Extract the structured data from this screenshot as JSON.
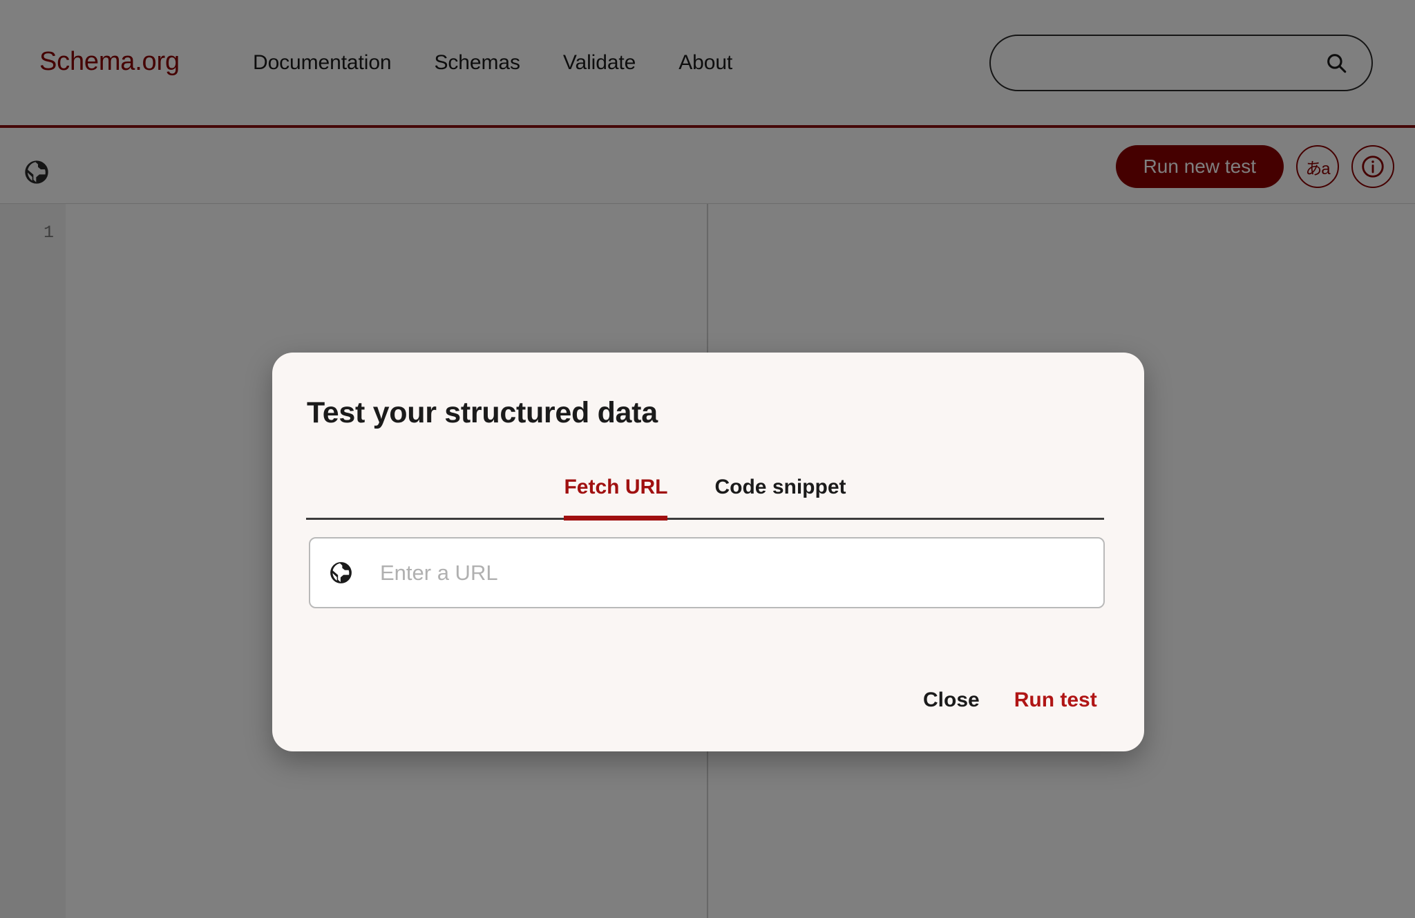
{
  "header": {
    "logo": "Schema.org",
    "nav": [
      {
        "label": "Documentation"
      },
      {
        "label": "Schemas"
      },
      {
        "label": "Validate"
      },
      {
        "label": "About"
      }
    ],
    "search": {
      "value": "",
      "placeholder": "",
      "icon": "search-icon"
    },
    "accent_color": "#8b0000",
    "border_color": "#8b0e0e"
  },
  "toolbar": {
    "globe_icon": "globe-icon",
    "run_new_test_label": "Run new test",
    "language_toggle_label": "あa",
    "info_icon": "info-icon",
    "button_color": "#8b0000"
  },
  "editor": {
    "line_numbers": [
      "1"
    ],
    "content": "",
    "gutter_color": "#f2f2f2"
  },
  "modal": {
    "title": "Test your structured data",
    "tabs": [
      {
        "label": "Fetch URL",
        "active": true
      },
      {
        "label": "Code snippet",
        "active": false
      }
    ],
    "url_field": {
      "icon": "globe-icon",
      "value": "",
      "placeholder": "Enter a URL"
    },
    "actions": {
      "close_label": "Close",
      "run_test_label": "Run test"
    },
    "background_color": "#faf6f4",
    "active_tab_color": "#a01010",
    "run_test_color": "#b01515"
  }
}
